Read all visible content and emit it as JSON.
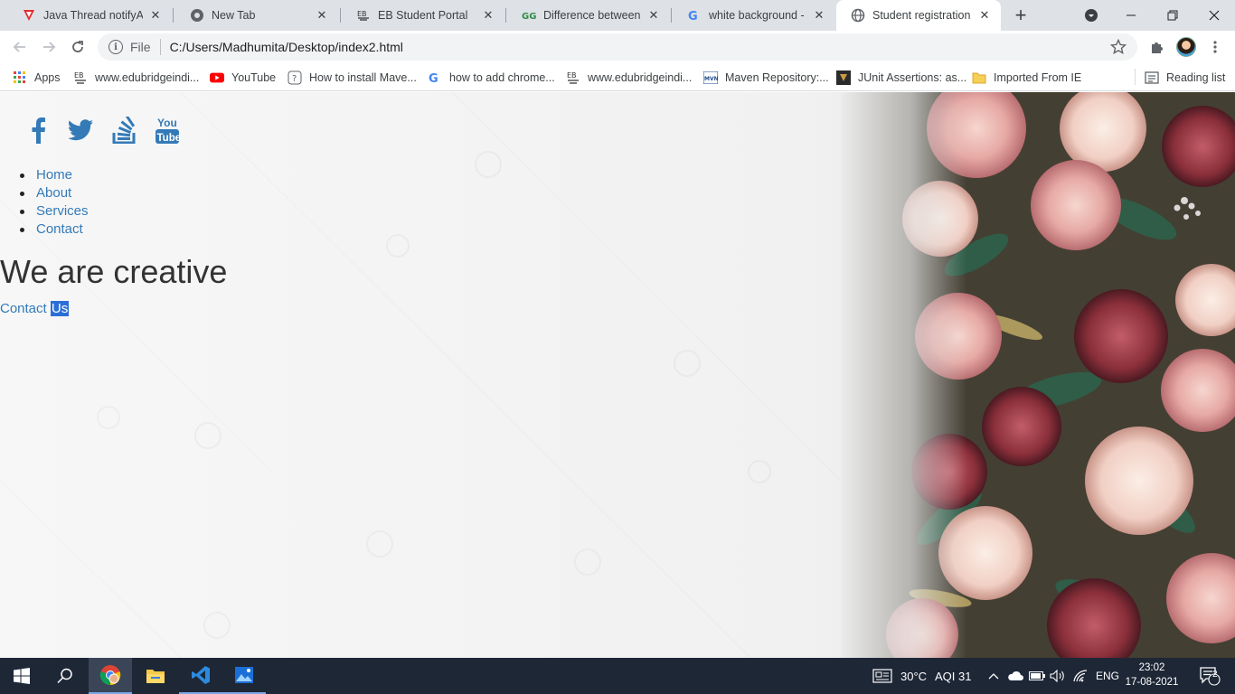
{
  "browser": {
    "tabs": [
      {
        "title": "Java Thread notifyAll()",
        "favicon": "vivaldi-red-icon"
      },
      {
        "title": "New Tab",
        "favicon": "chrome-globe-icon"
      },
      {
        "title": "EB Student Portal",
        "favicon": "eb-icon"
      },
      {
        "title": "Difference between nc",
        "favicon": "gfg-icon"
      },
      {
        "title": "white background - Go",
        "favicon": "google-icon"
      },
      {
        "title": "Student registration co",
        "favicon": "globe-icon"
      }
    ],
    "active_tab_index": 5,
    "address": {
      "scheme": "File",
      "url": "C:/Users/Madhumita/Desktop/index2.html"
    },
    "bookmarks": [
      {
        "label": "Apps",
        "icon": "apps-grid-icon"
      },
      {
        "label": "www.edubridgeindi...",
        "icon": "eb-icon"
      },
      {
        "label": "YouTube",
        "icon": "youtube-icon"
      },
      {
        "label": "How to install Mave...",
        "icon": "question-icon"
      },
      {
        "label": "how to add chrome...",
        "icon": "google-icon"
      },
      {
        "label": "www.edubridgeindi...",
        "icon": "eb-icon"
      },
      {
        "label": "Maven Repository:...",
        "icon": "mvn-icon"
      },
      {
        "label": "JUnit Assertions: as...",
        "icon": "junit-icon"
      },
      {
        "label": "Imported From IE",
        "icon": "folder-icon"
      }
    ],
    "reading_list": "Reading list"
  },
  "page": {
    "social_icons": [
      "facebook-icon",
      "twitter-icon",
      "stackoverflow-icon",
      "youtube-icon"
    ],
    "youtube_text": {
      "you": "You",
      "tube": "Tube"
    },
    "nav": [
      {
        "label": "Home"
      },
      {
        "label": "About"
      },
      {
        "label": "Services"
      },
      {
        "label": "Contact"
      }
    ],
    "heading": "We are creative",
    "contact_link": {
      "word1": "Contact",
      "word2": "Us"
    },
    "link_color": "#337ab7"
  },
  "taskbar": {
    "weather": "30°C",
    "aqi": "AQI 31",
    "language": "ENG",
    "time": "23:02",
    "date": "17-08-2021",
    "notification_count": "2"
  }
}
